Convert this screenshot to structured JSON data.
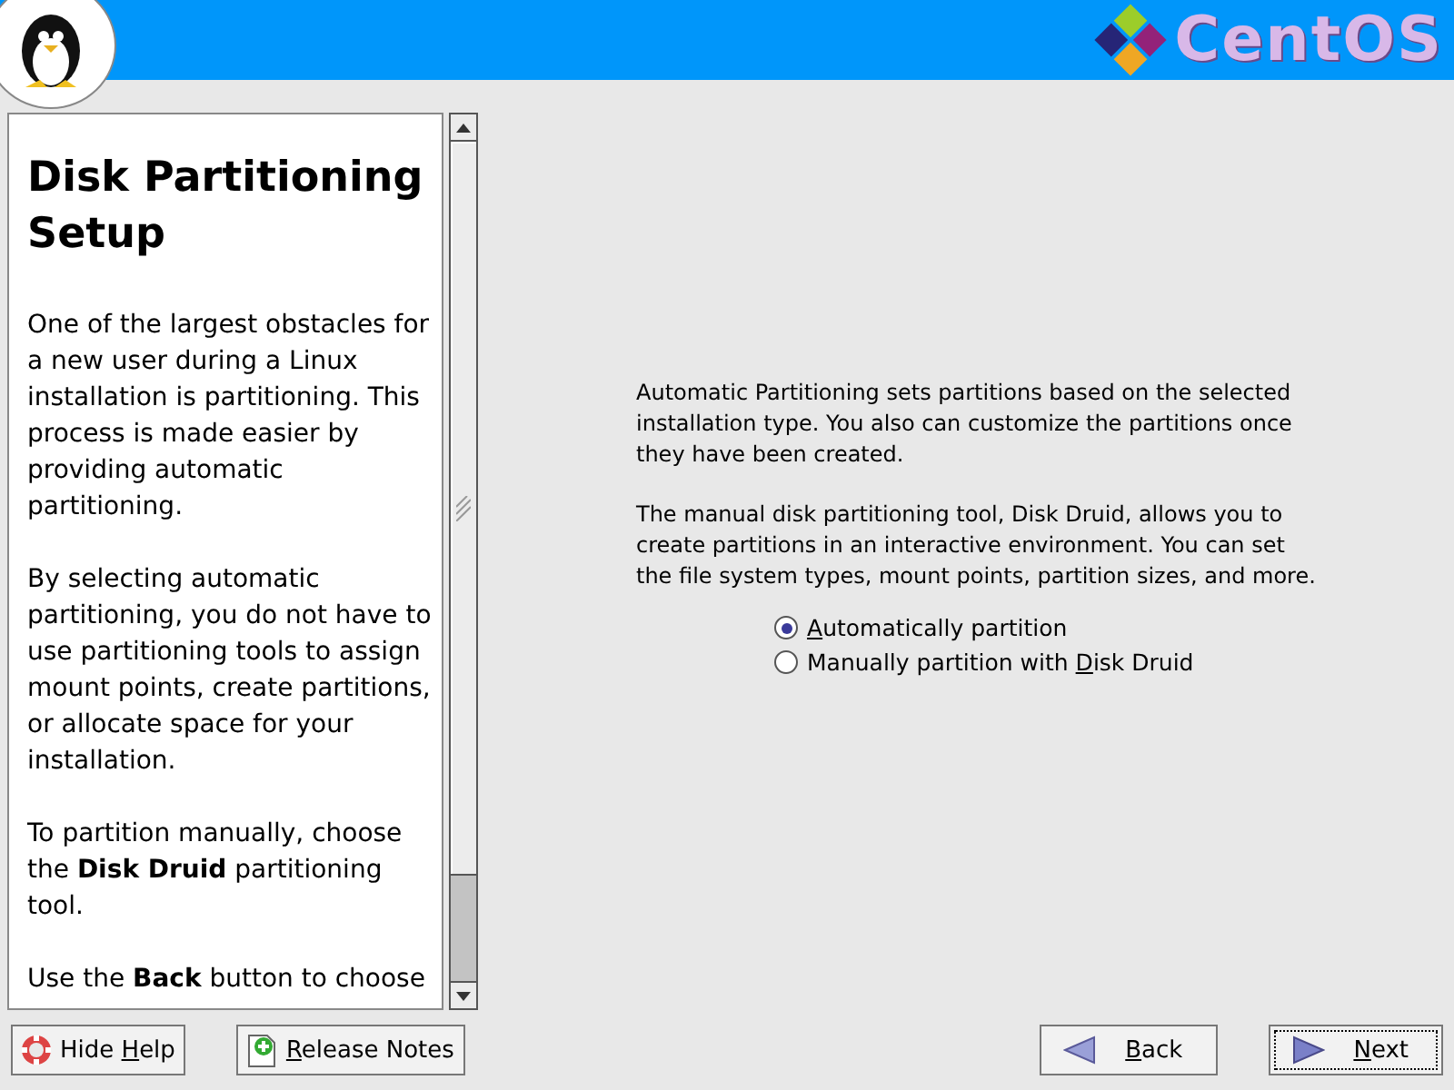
{
  "header": {
    "brand": "CentOS"
  },
  "help": {
    "title": "Disk Partitioning Setup",
    "paragraphs": [
      "One of the largest obstacles for a new user during a Linux installation is partitioning. This process is made easier by providing automatic partitioning.",
      "By selecting automatic partitioning, you do not have to use partitioning tools to assign mount points, create partitions, or allocate space for your installation.",
      "To partition manually, choose the **Disk Druid** partitioning tool.",
      "Use the **Back** button to choose"
    ]
  },
  "content": {
    "paragraphs": [
      "Automatic Partitioning sets partitions based on the selected installation type. You also can customize the partitions once they have been created.",
      "The manual disk partitioning tool, Disk Druid, allows you to create partitions in an interactive environment. You can set the file system types, mount points, partition sizes, and more."
    ],
    "options": [
      {
        "key": "A",
        "after": "utomatically partition",
        "selected": true
      },
      {
        "before": "Manually partition with ",
        "key": "D",
        "after": "isk Druid",
        "selected": false
      }
    ]
  },
  "buttons": [
    {
      "kind": "help",
      "before": "Hide ",
      "key": "H",
      "after": "elp",
      "focused": false
    },
    {
      "kind": "notes",
      "key": "R",
      "after": "elease Notes",
      "focused": false
    },
    {
      "kind": "back",
      "key": "B",
      "after": "ack",
      "focused": false
    },
    {
      "kind": "next",
      "key": "N",
      "after": "ext",
      "focused": true
    }
  ]
}
